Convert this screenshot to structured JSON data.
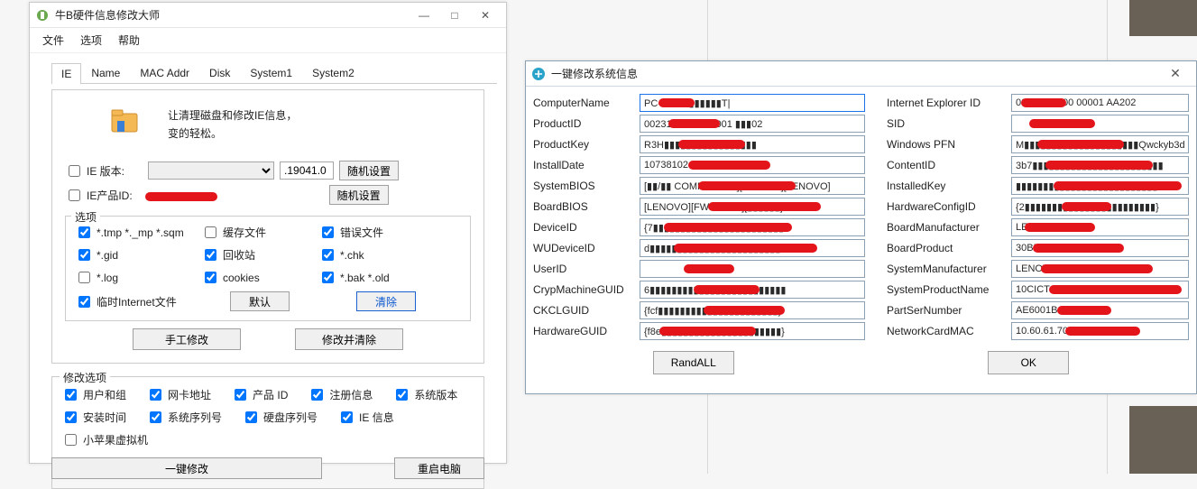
{
  "left_window": {
    "title": "牛B硬件信息修改大师",
    "menu": {
      "file": "文件",
      "options": "选项",
      "help": "帮助"
    },
    "tabs": [
      "IE",
      "Name",
      "MAC Addr",
      "Disk",
      "System1",
      "System2"
    ],
    "ie_tab": {
      "desc_line1": "让清理磁盘和修改IE信息，",
      "desc_line2": "变的轻松。",
      "ie_version_label": "IE 版本:",
      "ie_version_value": "",
      "ie_version_build": ".19041.0",
      "btn_random1": "随机设置",
      "ie_product_label": "IE产品ID:",
      "btn_random2": "随机设置",
      "options_legend": "选项",
      "opt_tmp": "*.tmp *._mp *.sqm",
      "opt_cache": "缓存文件",
      "opt_errfile": "错误文件",
      "opt_gid": "*.gid",
      "opt_recycle": "回收站",
      "opt_chk": "*.chk",
      "opt_log": "*.log",
      "opt_cookies": "cookies",
      "opt_bak": "*.bak *.old",
      "opt_inetfiles": "临时Internet文件",
      "btn_default": "默认",
      "btn_clear": "清除",
      "btn_manual": "手工修改",
      "btn_modifyclear": "修改并清除"
    },
    "modify_group": {
      "legend": "修改选项",
      "items": {
        "usersgroups": "用户和组",
        "nicaddr": "网卡地址",
        "productid": "产品 ID",
        "reginfo": "注册信息",
        "sysver": "系统版本",
        "installtime": "安装时间",
        "sysserial": "系统序列号",
        "diskserial": "硬盘序列号",
        "ieinfo": "IE 信息",
        "xpgvm": "小苹果虚拟机"
      },
      "btn_oneclick": "一键修改",
      "btn_reboot": "重启电脑"
    }
  },
  "right_window": {
    "title": "一键修改系统信息",
    "left_fields": {
      "ComputerName": "PC-20230▮▮▮▮▮▮T|",
      "ProductID": "00231 10000 00001 ▮▮▮02",
      "ProductKey": "R3H▮▮▮▮▮▮▮▮▮▮▮▮▮▮▮▮▮",
      "InstallDate": "1073810245",
      "SystemBIOS": "[▮▮/▮▮ COMPATIBLE][00/12/15][LENOVO]",
      "BoardBIOS": "[LENOVO][FWKTEAA][▮▮▮▮▮▮]",
      "DeviceID": "{7▮▮▮▮▮▮▮▮▮▮▮▮▮▮▮▮▮▮▮▮▮▮▮▮",
      "WUDeviceID": "d▮▮▮▮▮▮▮▮▮▮▮▮▮▮▮▮▮▮▮▮▮▮▮▮",
      "UserID": "",
      "CrypMachineGUID": "6▮▮▮▮▮▮▮▮▮▮▮▮▮▮▮▮▮▮▮▮▮▮▮▮▮",
      "CKCLGUID": "{fcf▮▮▮▮▮▮▮▮▮▮▮▮▮▮▮▮▮▮▮▮▮▮}",
      "HardwareGUID": "{f8e▮▮▮▮▮▮▮▮▮▮▮▮▮▮▮▮▮▮▮▮▮▮}"
    },
    "right_fields": {
      "Internet Explorer ID": "00331 10000 00001 AA202",
      "SID": "",
      "Windows PFN": "M▮▮▮▮▮▮▮▮▮▮▮▮▮▮▮▮▮▮▮▮▮Qwckyb3d",
      "ContentID": "3b7▮▮▮▮▮▮▮▮▮▮▮▮▮▮▮▮▮▮▮▮▮▮▮▮",
      "InstalledKey": "▮▮▮▮▮▮▮▮▮▮▮▮▮▮▮▮▮▮▮▮▮▮▮▮▮▮",
      "HardwareConfigID": "{2▮▮▮▮▮▮▮▮▮▮▮▮▮▮▮▮▮▮▮▮▮▮▮▮}",
      "BoardManufacturer": "LENOVO",
      "BoardProduct": "30BD",
      "SystemManufacturer": "LENOVO",
      "SystemProductName": "10CICTO1WW",
      "PartSerNumber": "AE6001BC",
      "NetworkCardMAC": "10.60.61.70.75.5B"
    },
    "btn_randall": "RandALL",
    "btn_ok": "OK"
  }
}
